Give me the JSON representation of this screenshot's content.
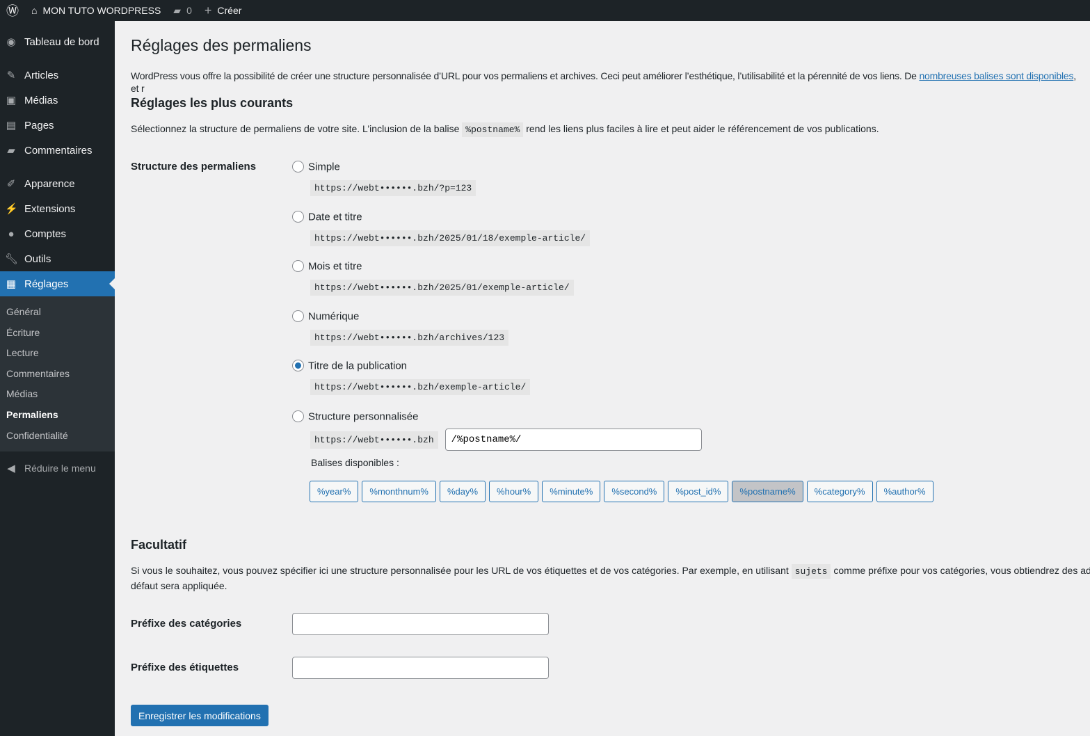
{
  "adminbar": {
    "site": "MON TUTO WORDPRESS",
    "comments": "0",
    "create": "Créer"
  },
  "sidebar": {
    "items": [
      "Tableau de bord",
      "Articles",
      "Médias",
      "Pages",
      "Commentaires",
      "Apparence",
      "Extensions",
      "Comptes",
      "Outils",
      "Réglages"
    ],
    "submenu": [
      "Général",
      "Écriture",
      "Lecture",
      "Commentaires",
      "Médias",
      "Permaliens",
      "Confidentialité"
    ],
    "collapse": "Réduire le menu"
  },
  "page": {
    "title": "Réglages des permaliens",
    "intro": "WordPress vous offre la possibilité de créer une structure personnalisée d’URL pour vos permaliens et archives. Ceci peut améliorer l’esthétique, l’utilisabilité et la pérennité de vos liens. De ",
    "intro_link": "nombreuses balises sont disponibles",
    "intro_end": ", et r",
    "common_heading": "Réglages les plus courants",
    "common_desc_1": "Sélectionnez la structure de permaliens de votre site. L’inclusion de la balise",
    "common_code": "%postname%",
    "common_desc_2": "rend les liens plus faciles à lire et peut aider le référencement de vos publications.",
    "structure_label": "Structure des permaliens",
    "options": [
      {
        "label": "Simple",
        "url": "https://webt••••••.bzh/?p=123",
        "checked": false
      },
      {
        "label": "Date et titre",
        "url": "https://webt••••••.bzh/2025/01/18/exemple-article/",
        "checked": false
      },
      {
        "label": "Mois et titre",
        "url": "https://webt••••••.bzh/2025/01/exemple-article/",
        "checked": false
      },
      {
        "label": "Numérique",
        "url": "https://webt••••••.bzh/archives/123",
        "checked": false
      },
      {
        "label": "Titre de la publication",
        "url": "https://webt••••••.bzh/exemple-article/",
        "checked": true
      }
    ],
    "custom": {
      "label": "Structure personnalisée",
      "base": "https://webt••••••.bzh",
      "value": "/%postname%/",
      "tags_label": "Balises disponibles :",
      "tags": [
        "%year%",
        "%monthnum%",
        "%day%",
        "%hour%",
        "%minute%",
        "%second%",
        "%post_id%",
        "%postname%",
        "%category%",
        "%author%"
      ]
    },
    "optional_heading": "Facultatif",
    "optional_desc_1": "Si vous le souhaitez, vous pouvez spécifier ici une structure personnalisée pour les URL de vos étiquettes et de vos catégories. Par exemple, en utilisant",
    "optional_code": "sujets",
    "optional_desc_2": "comme préfixe pour vos catégories, vous obtiendrez des adresses w",
    "optional_desc_3": "défaut sera appliquée.",
    "category_label": "Préfixe des catégories",
    "tag_label": "Préfixe des étiquettes",
    "save": "Enregistrer les modifications"
  }
}
